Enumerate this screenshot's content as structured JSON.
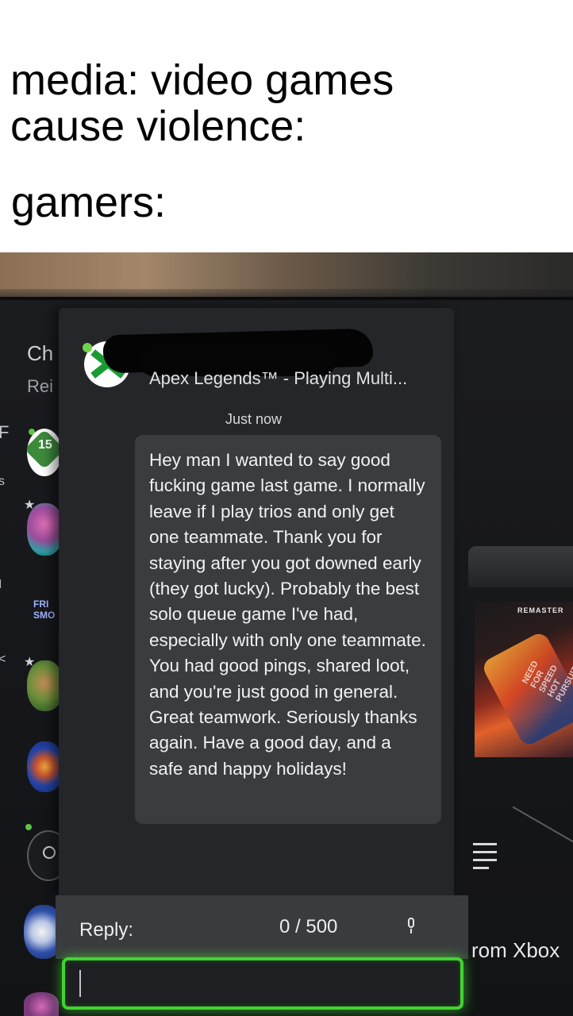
{
  "caption": {
    "line1": "media: video games",
    "line2": "cause violence:",
    "line3": "gamers:"
  },
  "sidebar": {
    "title_partial": "Ch",
    "subtitle_partial": "Rei",
    "badge_number": "15",
    "tile_label_partial": "FRI SMO"
  },
  "message": {
    "game_status": "Apex Legends™ - Playing Multi...",
    "timestamp": "Just now",
    "body": "Hey man I wanted to say good fucking game last game. I normally leave if I play trios and only get one teammate. Thank you for staying after you got downed early (they got lucky). Probably the best solo queue game I've had, especially with only one teammate. You had good pings, shared loot, and you're just good in general. Great teamwork. Seriously thanks again. Have a good day, and a safe and happy holidays!"
  },
  "reply": {
    "label": "Reply:",
    "char_count": "0 / 500",
    "value": ""
  },
  "background": {
    "game_tile_label": "REMASTER",
    "game_tile_title": "NEED FOR SPEED HOT PURSUIT",
    "footer_partial": "rom Xbox"
  },
  "icons": [
    "xbox-logo-icon",
    "microphone-icon",
    "person-icon",
    "list-icon",
    "star-icon"
  ],
  "colors": {
    "focus_green": "#41d42f",
    "xbox_green": "#1a9b32",
    "panel_bg": "#25262a",
    "bubble_bg": "#3b3c40"
  }
}
